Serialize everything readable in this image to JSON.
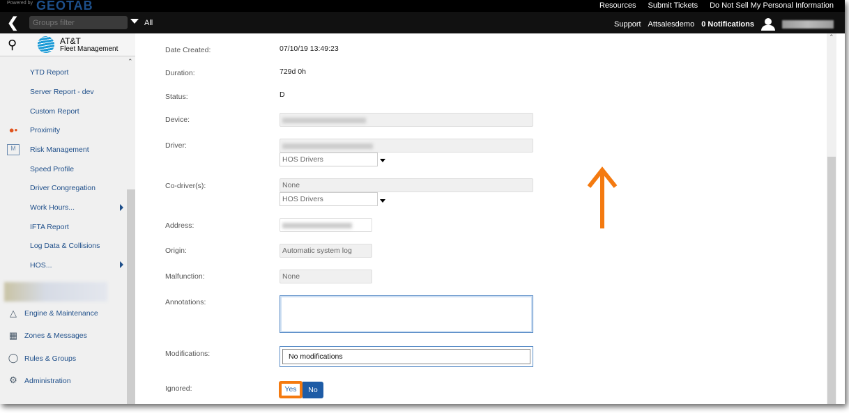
{
  "topbar": {
    "powered": "Powered by",
    "brand": "GEOTAB",
    "links": [
      "Resources",
      "Submit Tickets",
      "Do Not Sell My Personal Information"
    ]
  },
  "navbar": {
    "groups_placeholder": "Groups filter",
    "groups_value": "All",
    "support": "Support",
    "account": "Attsalesdemo",
    "notifications": "0 Notifications"
  },
  "sidebar": {
    "logo_line1": "AT&T",
    "logo_line2": "Fleet Management",
    "items": [
      "YTD Report",
      "Server Report - dev",
      "Custom Report",
      "Proximity",
      "Risk Management",
      "Speed Profile",
      "Driver Congregation",
      "Work Hours...",
      "IFTA Report",
      "Log Data & Collisions",
      "HOS..."
    ],
    "sections": [
      "Engine & Maintenance",
      "Zones & Messages",
      "Rules & Groups",
      "Administration"
    ]
  },
  "form": {
    "date_created_label": "Date Created:",
    "date_created": "07/10/19 13:49:23",
    "duration_label": "Duration:",
    "duration": "729d 0h",
    "status_label": "Status:",
    "status": "D",
    "device_label": "Device:",
    "driver_label": "Driver:",
    "driver_group": "HOS Drivers",
    "codriver_label": "Co-driver(s):",
    "codriver": "None",
    "codriver_group": "HOS Drivers",
    "address_label": "Address:",
    "origin_label": "Origin:",
    "origin": "Automatic system log",
    "malfunction_label": "Malfunction:",
    "malfunction": "None",
    "annotations_label": "Annotations:",
    "modifications_label": "Modifications:",
    "modifications": "No modifications",
    "ignored_label": "Ignored:",
    "yes": "Yes",
    "no": "No"
  },
  "colors": {
    "accent": "#f47a10",
    "primary": "#1e5ca6"
  }
}
